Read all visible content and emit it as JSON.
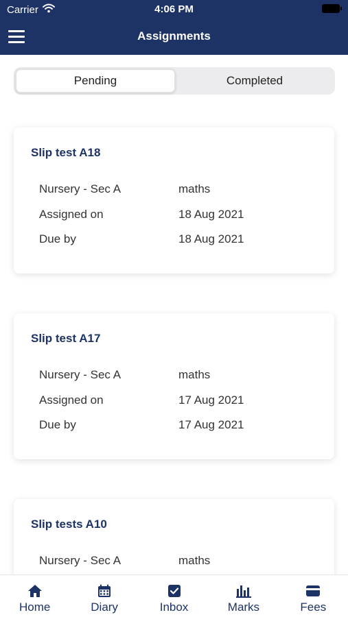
{
  "status_bar": {
    "carrier": "Carrier",
    "time": "4:06 PM"
  },
  "header": {
    "title": "Assignments"
  },
  "segments": [
    {
      "label": "Pending",
      "active": true
    },
    {
      "label": "Completed",
      "active": false
    }
  ],
  "row_labels": {
    "assigned": "Assigned on",
    "due": "Due by"
  },
  "assignments": [
    {
      "title": "Slip test A18",
      "class": "Nursery - Sec A",
      "subject": "maths",
      "assigned_on": "18 Aug 2021",
      "due_by": "18 Aug 2021"
    },
    {
      "title": "Slip test A17",
      "class": "Nursery - Sec A",
      "subject": "maths",
      "assigned_on": "17 Aug 2021",
      "due_by": "17 Aug 2021"
    },
    {
      "title": "Slip tests A10",
      "class": "Nursery - Sec A",
      "subject": "maths"
    }
  ],
  "tabs": [
    {
      "label": "Home",
      "icon": "home-icon"
    },
    {
      "label": "Diary",
      "icon": "calendar-icon"
    },
    {
      "label": "Inbox",
      "icon": "checkbox-icon"
    },
    {
      "label": "Marks",
      "icon": "bar-chart-icon"
    },
    {
      "label": "Fees",
      "icon": "credit-card-icon"
    }
  ],
  "colors": {
    "primary": "#1d3366",
    "background": "#ffffff",
    "segment_bg": "#ececee"
  }
}
